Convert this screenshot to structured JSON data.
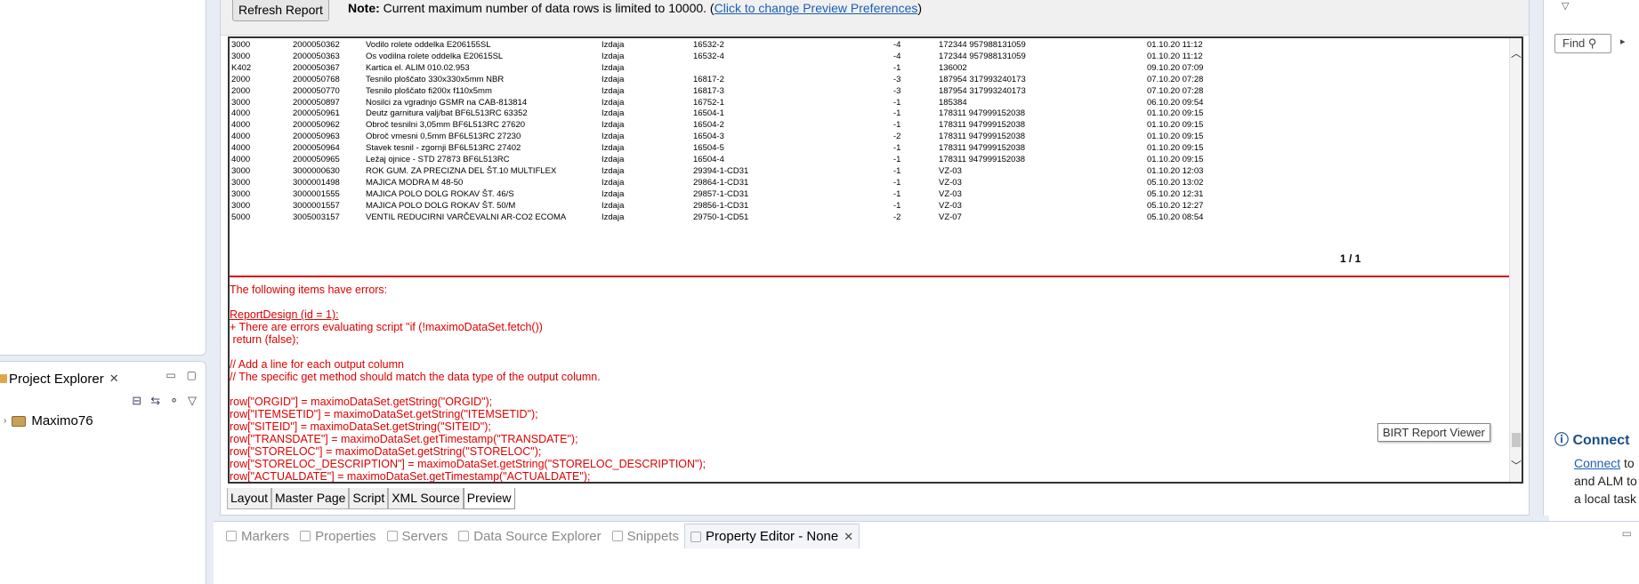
{
  "toolbar": {
    "refresh_label": "Refresh Report",
    "note_bold": "Note:",
    "note_text": "Current maximum number of data rows is limited to 10000. (",
    "note_link": "Click to change Preview Preferences",
    "note_end": ")"
  },
  "rows": [
    [
      "3000",
      "2000050362",
      "Vodilo rolete oddelka E206155SL",
      "Izdaja",
      "16532-2",
      "-4",
      "172344 957988131059",
      "01.10.20 11:12"
    ],
    [
      "3000",
      "2000050363",
      "Os vodilna rolete oddelka E20615SL",
      "Izdaja",
      "16532-4",
      "-4",
      "172344 957988131059",
      "01.10.20 11:12"
    ],
    [
      "K402",
      "2000050367",
      "Kartica el. ALIM 010.02.953",
      "Izdaja",
      "",
      "-1",
      "136002",
      "09.10.20 07:09"
    ],
    [
      "2000",
      "2000050768",
      "Tesnilo ploščato 330x330x5mm NBR",
      "Izdaja",
      "16817-2",
      "-3",
      "187954 317993240173",
      "07.10.20 07:28"
    ],
    [
      "2000",
      "2000050770",
      "Tesnilo ploščato fi200x f110x5mm",
      "Izdaja",
      "16817-3",
      "-3",
      "187954 317993240173",
      "07.10.20 07:28"
    ],
    [
      "3000",
      "2000050897",
      "Nosilci za vgradnjo GSMR na CAB-813814",
      "Izdaja",
      "16752-1",
      "-1",
      "185384",
      "06.10.20 09:54"
    ],
    [
      "4000",
      "2000050961",
      "Deutz garnitura valj/bat BF6L513RC 63352",
      "Izdaja",
      "16504-1",
      "-1",
      "178311 947999152038",
      "01.10.20 09:15"
    ],
    [
      "4000",
      "2000050962",
      "Obroč tesnilni 3,05mm BF6L513RC 27620",
      "Izdaja",
      "16504-2",
      "-1",
      "178311 947999152038",
      "01.10.20 09:15"
    ],
    [
      "4000",
      "2000050963",
      "Obroč vmesni 0,5mm BF6L513RC  27230",
      "Izdaja",
      "16504-3",
      "-2",
      "178311 947999152038",
      "01.10.20 09:15"
    ],
    [
      "4000",
      "2000050964",
      "Stavek tesnil - zgornji BF6L513RC  27402",
      "Izdaja",
      "16504-5",
      "-1",
      "178311 947999152038",
      "01.10.20 09:15"
    ],
    [
      "4000",
      "2000050965",
      "Ležaj ojnice - STD 27873 BF6L513RC",
      "Izdaja",
      "16504-4",
      "-1",
      "178311 947999152038",
      "01.10.20 09:15"
    ],
    [
      "3000",
      "3000000630",
      "ROK GUM. ZA PRECIZNA DEL ŠT.10 MULTIFLEX",
      "Izdaja",
      "29394-1-CD31",
      "-1",
      "VZ-03",
      "01.10.20 12:03"
    ],
    [
      "3000",
      "3000001498",
      "MAJICA MODRA M 48-50",
      "Izdaja",
      "29864-1-CD31",
      "-1",
      "VZ-03",
      "05.10.20 13:02"
    ],
    [
      "3000",
      "3000001555",
      "MAJICA POLO DOLG ROKAV ŠT. 46/S",
      "Izdaja",
      "29857-1-CD31",
      "-1",
      "VZ-03",
      "05.10.20 12:31"
    ],
    [
      "3000",
      "3000001557",
      "MAJICA POLO DOLG ROKAV ŠT. 50/M",
      "Izdaja",
      "29856-1-CD31",
      "-1",
      "VZ-03",
      "05.10.20 12:27"
    ],
    [
      "5000",
      "3005003157",
      "VENTIL REDUCIRNI VARČEVALNI AR-CO2 ECOMA",
      "Izdaja",
      "29750-1-CD51",
      "-2",
      "VZ-07",
      "05.10.20 08:54"
    ]
  ],
  "page_indicator": "1 / 1",
  "errors": [
    "The following items have errors:",
    "",
    "ReportDesign (id = 1):",
    "+ There are errors evaluating script \"if (!maximoDataSet.fetch())",
    " return (false);",
    "",
    "// Add a line for each output column",
    "// The specific get method should match the data type of the output column.",
    "",
    "row[\"ORGID\"] = maximoDataSet.getString(\"ORGID\");",
    "row[\"ITEMSETID\"] = maximoDataSet.getString(\"ITEMSETID\");",
    "row[\"SITEID\"] = maximoDataSet.getString(\"SITEID\");",
    "row[\"TRANSDATE\"] = maximoDataSet.getTimestamp(\"TRANSDATE\");",
    "row[\"STORELOC\"] = maximoDataSet.getString(\"STORELOC\");",
    "row[\"STORELOC_DESCRIPTION\"] = maximoDataSet.getString(\"STORELOC_DESCRIPTION\");",
    "row[\"ACTUALDATE\"] = maximoDataSet.getTimestamp(\"ACTUALDATE\");"
  ],
  "tooltip": "BIRT Report Viewer",
  "editor_tabs": [
    "Layout",
    "Master Page",
    "Script",
    "XML Source",
    "Preview"
  ],
  "project_explorer": {
    "title": "Project Explorer",
    "node": "Maximo76"
  },
  "right": {
    "find_label": "Find",
    "connect_title": "Connect",
    "connect_line1_link": "Connect",
    "connect_line1_rest": " to",
    "connect_line2": "and ALM to",
    "connect_line3": "a local task"
  },
  "bottom_tabs": [
    "Markers",
    "Properties",
    "Servers",
    "Data Source Explorer",
    "Snippets",
    "Property Editor - None"
  ],
  "colors": {
    "error_red": "#e00000",
    "link_blue": "#1a5fb4",
    "panel_border": "#c9d3e2"
  }
}
